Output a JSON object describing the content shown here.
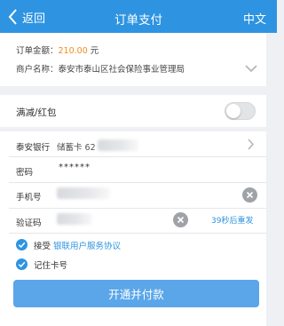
{
  "header": {
    "back_label": "返回",
    "title": "订单支付",
    "language_label": "中文"
  },
  "order": {
    "amount_label": "订单金额：",
    "amount_value": "210.00",
    "amount_unit": "元",
    "merchant_label": "商户名称：",
    "merchant_value": "泰安市泰山区社会保险事业管理局"
  },
  "discount": {
    "label": "满减/红包",
    "enabled": false
  },
  "payment": {
    "bank_name": "泰安银行",
    "card_text": "储蓄卡 62",
    "password_label": "密码",
    "password_mask": "******",
    "phone_label": "手机号",
    "code_label": "验证码",
    "resend_label": "39秒后重发",
    "agree_prefix": "接受",
    "agree_link": "银联用户服务协议",
    "remember_label": "记住卡号",
    "submit_label": "开通并付款"
  },
  "colors": {
    "primary": "#2e94e1",
    "button": "#5aa6e8",
    "amount": "#f08a1c",
    "background": "#eef0f3"
  },
  "icons": {
    "back": "chevron-left-icon",
    "expand": "chevron-down-icon",
    "next": "chevron-right-icon",
    "clear": "clear-circle-icon",
    "check": "check-circle-icon"
  }
}
